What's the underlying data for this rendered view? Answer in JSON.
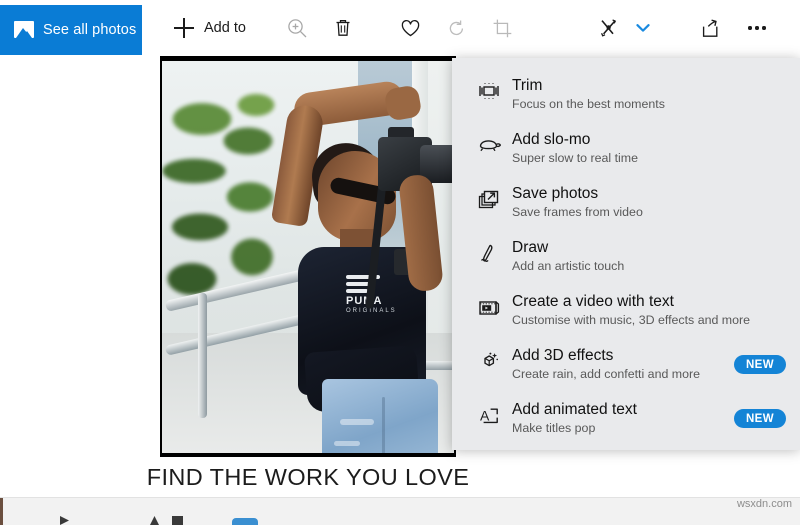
{
  "toolbar": {
    "see_all_photos": "See all photos",
    "see_all_photos_icon": "picture-icon",
    "add_to": "Add to",
    "add_to_icon": "plus-icon",
    "buttons": [
      {
        "name": "zoom-icon",
        "tooltip": "Zoom"
      },
      {
        "name": "delete-icon",
        "tooltip": "Delete"
      },
      {
        "name": "heart-icon",
        "tooltip": "Add to favourites"
      },
      {
        "name": "rotate-icon",
        "tooltip": "Rotate"
      },
      {
        "name": "crop-icon",
        "tooltip": "Crop and rotate"
      },
      {
        "name": "edit-create-icon",
        "tooltip": "Edit & create"
      },
      {
        "name": "chevron-down-icon",
        "tooltip": "Open edit and create menu"
      },
      {
        "name": "share-icon",
        "tooltip": "Share"
      },
      {
        "name": "more-icon",
        "tooltip": "See more"
      }
    ]
  },
  "menu": {
    "items": [
      {
        "icon": "trim-icon",
        "title": "Trim",
        "subtitle": "Focus on the best moments",
        "badge": ""
      },
      {
        "icon": "turtle-icon",
        "title": "Add slo-mo",
        "subtitle": "Super slow to real time",
        "badge": ""
      },
      {
        "icon": "save-photos-icon",
        "title": "Save photos",
        "subtitle": "Save frames from video",
        "badge": ""
      },
      {
        "icon": "pen-icon",
        "title": "Draw",
        "subtitle": "Add an artistic touch",
        "badge": ""
      },
      {
        "icon": "video-text-icon",
        "title": "Create a video with text",
        "subtitle": "Customise with music, 3D effects and more",
        "badge": ""
      },
      {
        "icon": "cube-sparkle-icon",
        "title": "Add 3D effects",
        "subtitle": "Create rain, add confetti and more",
        "badge": "NEW"
      },
      {
        "icon": "animated-text-icon",
        "title": "Add animated text",
        "subtitle": "Make titles pop",
        "badge": "NEW"
      }
    ]
  },
  "photo": {
    "caption": "FIND THE WORK YOU LOVE",
    "shirt_logo_word": "PUMA",
    "shirt_logo_sub": "ORIGINALS"
  },
  "watermark": "wsxdn.com",
  "colors": {
    "accent_blue": "#0a7cd5",
    "badge_blue": "#1484d6",
    "menu_background": "#e9eaec",
    "chevron_blue": "#1a8ae0"
  }
}
